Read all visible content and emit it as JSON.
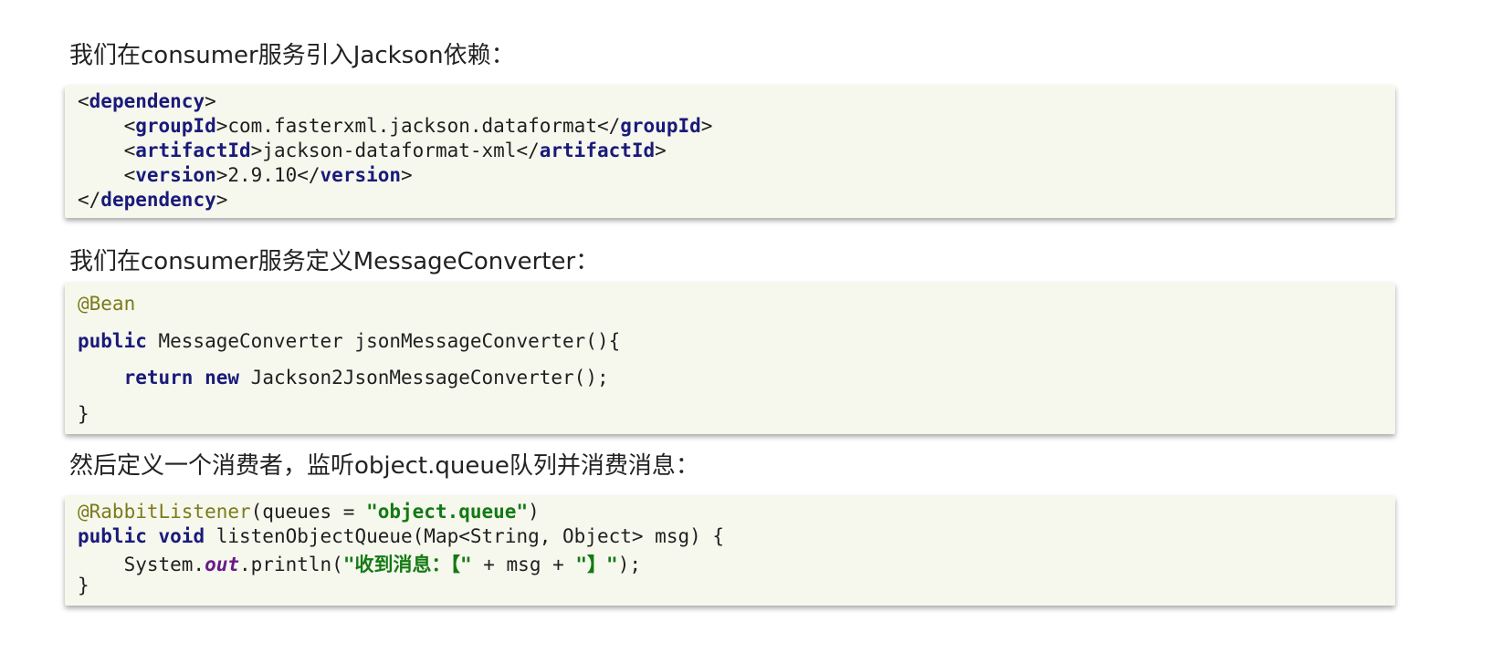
{
  "sections": {
    "s1_heading": "我们在consumer服务引入Jackson依赖：",
    "s2_heading": "我们在consumer服务定义MessageConverter：",
    "s3_heading": "然后定义一个消费者，监听object.queue队列并消费消息："
  },
  "code1": {
    "l1_open": "<",
    "l1_tag": "dependency",
    "l1_close": ">",
    "l2_indent": "    <",
    "l2_tag": "groupId",
    "l2_mid": ">com.fasterxml.jackson.dataformat</",
    "l2_tag2": "groupId",
    "l2_end": ">",
    "l3_indent": "    <",
    "l3_tag": "artifactId",
    "l3_mid": ">jackson-dataformat-xml</",
    "l3_tag2": "artifactId",
    "l3_end": ">",
    "l4_indent": "    <",
    "l4_tag": "version",
    "l4_mid": ">2.9.10</",
    "l4_tag2": "version",
    "l4_end": ">",
    "l5_open": "</",
    "l5_tag": "dependency",
    "l5_close": ">"
  },
  "code2": {
    "annotation": "@Bean",
    "l2_kw": "public",
    "l2_rest": " MessageConverter jsonMessageConverter(){",
    "l3_indent": "    ",
    "l3_kw1": "return",
    "l3_sp": " ",
    "l3_kw2": "new",
    "l3_rest": " Jackson2JsonMessageConverter();",
    "l4": "}"
  },
  "code3": {
    "annotation": "@RabbitListener",
    "l1_mid": "(queues = ",
    "l1_str": "\"object.queue\"",
    "l1_end": ")",
    "l2_kw1": "public",
    "l2_sp": " ",
    "l2_kw2": "void",
    "l2_rest": " listenObjectQueue(Map<String, Object> msg) {",
    "l3_indent": "    System.",
    "l3_field": "out",
    "l3_mid": ".println(",
    "l3_str1": "\"收到消息：【\"",
    "l3_mid2": " + msg + ",
    "l3_str2": "\"】\"",
    "l3_end": ");",
    "l4": "}"
  }
}
